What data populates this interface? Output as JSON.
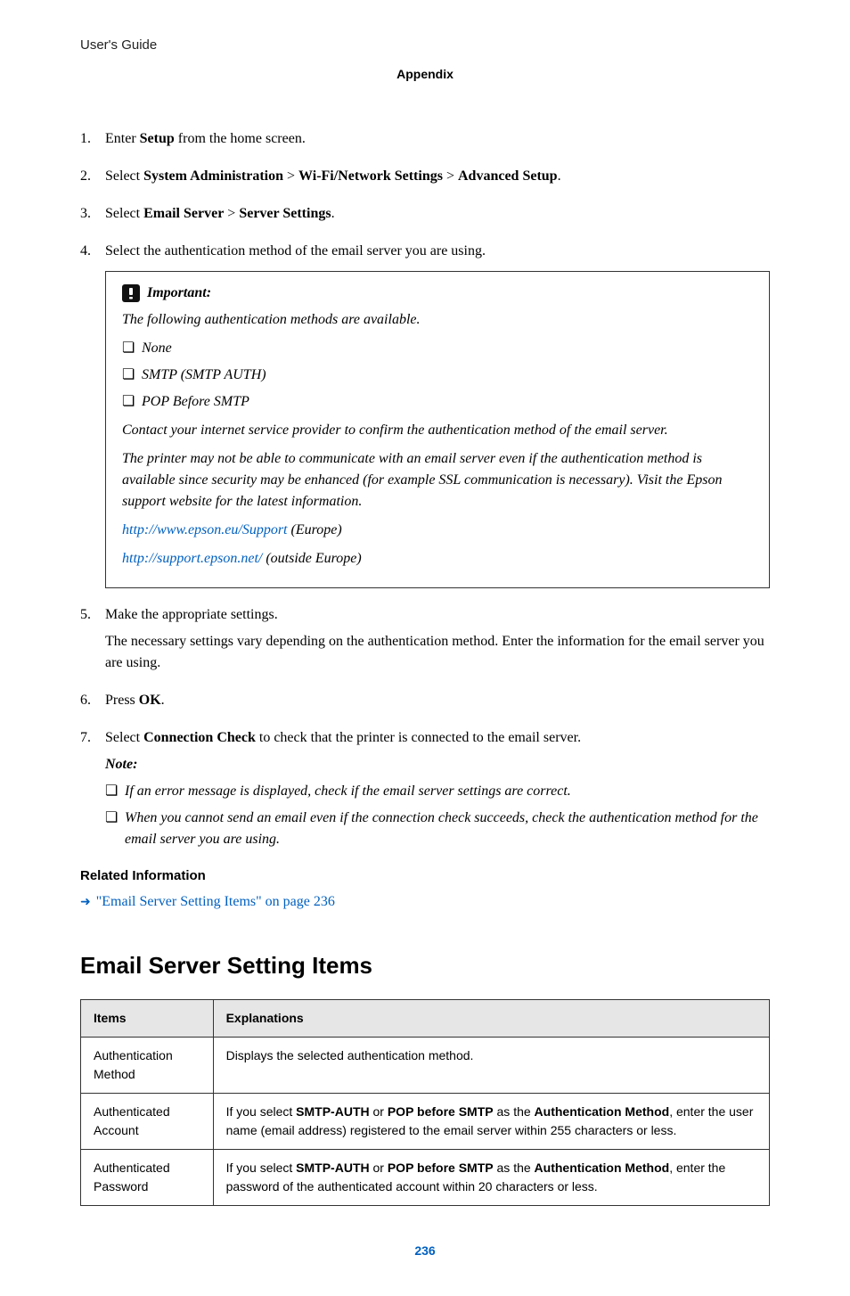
{
  "header": {
    "left": "User's Guide",
    "center": "Appendix"
  },
  "steps": [
    {
      "prefix": "Enter ",
      "bold1": "Setup",
      "suffix": " from the home screen."
    },
    {
      "prefix": "Select ",
      "bold1": "System Administration",
      "sep1": " > ",
      "bold2": "Wi-Fi/Network Settings",
      "sep2": " > ",
      "bold3": "Advanced Setup",
      "suffix": "."
    },
    {
      "prefix": "Select ",
      "bold1": "Email Server",
      "sep1": " > ",
      "bold2": "Server Settings",
      "suffix": "."
    },
    {
      "full": "Select the authentication method of the email server you are using."
    }
  ],
  "important": {
    "label": "Important:",
    "intro": "The following authentication methods are available.",
    "methods": [
      "None",
      "SMTP (SMTP AUTH)",
      "POP Before SMTP"
    ],
    "contact": "Contact your internet service provider to confirm the authentication method of the email server.",
    "warning": "The printer may not be able to communicate with an email server even if the authentication method is available since security may be enhanced (for example SSL communication is necessary). Visit the Epson support website for the latest information.",
    "link1_url": "http://www.epson.eu/Support",
    "link1_suffix": " (Europe)",
    "link2_url": "http://support.epson.net/",
    "link2_suffix": " (outside Europe)"
  },
  "step5": {
    "main": "Make the appropriate settings.",
    "sub": "The necessary settings vary depending on the authentication method. Enter the information for the email server you are using."
  },
  "step6": {
    "prefix": "Press ",
    "bold1": "OK",
    "suffix": "."
  },
  "step7": {
    "prefix": "Select ",
    "bold1": "Connection Check",
    "suffix": " to check that the printer is connected to the email server.",
    "note_label": "Note:",
    "notes": [
      "If an error message is displayed, check if the email server settings are correct.",
      "When you cannot send an email even if the connection check succeeds, check the authentication method for the email server you are using."
    ]
  },
  "related": {
    "heading": "Related Information",
    "link_text": "\"Email Server Setting Items\" on page 236"
  },
  "section": {
    "title": "Email Server Setting Items",
    "th1": "Items",
    "th2": "Explanations"
  },
  "chart_data": {
    "type": "table",
    "columns": [
      "Items",
      "Explanations"
    ],
    "rows": [
      {
        "item": "Authentication Method",
        "explanation_plain": "Displays the selected authentication method."
      },
      {
        "item": "Authenticated Account",
        "expl_p1": "If you select ",
        "expl_b1": "SMTP-AUTH",
        "expl_p2": " or ",
        "expl_b2": "POP before SMTP",
        "expl_p3": " as the ",
        "expl_b3": "Authentication Method",
        "expl_p4": ", enter the user name (email address) registered to the email server within 255 characters or less."
      },
      {
        "item": "Authenticated Password",
        "expl_p1": "If you select ",
        "expl_b1": "SMTP-AUTH",
        "expl_p2": " or ",
        "expl_b2": "POP before SMTP",
        "expl_p3": " as the ",
        "expl_b3": "Authentication Method",
        "expl_p4": ", enter the password of the authenticated account within 20 characters or less."
      }
    ]
  },
  "page_number": "236"
}
